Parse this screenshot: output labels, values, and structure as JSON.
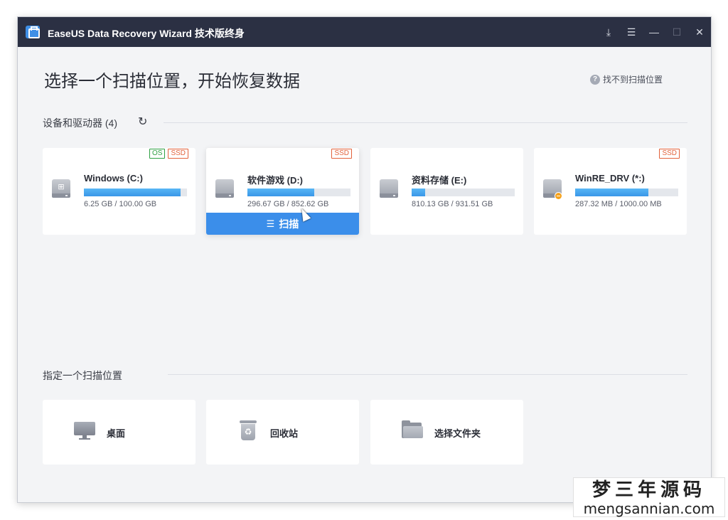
{
  "window": {
    "title": "EaseUS Data Recovery Wizard 技术版终身",
    "controls": [
      "⤓",
      "☰",
      "—",
      "☐",
      "✕"
    ]
  },
  "header": {
    "title": "选择一个扫描位置，开始恢复数据",
    "help_link": "找不到扫描位置",
    "help_icon": "?"
  },
  "devices": {
    "section_title": "设备和驱动器 (4)",
    "refresh_icon": "↻",
    "drives": [
      {
        "name": "Windows (C:)",
        "size": "6.25 GB / 100.00 GB",
        "tags": [
          "OS",
          "SSD"
        ],
        "bar_fill": 0.94,
        "icon": "windows-drive-icon"
      },
      {
        "name": "软件游戏 (D:)",
        "size": "296.67 GB / 852.62 GB",
        "tags": [
          "SSD"
        ],
        "bar_fill": 0.65,
        "icon": "hard-drive-icon",
        "scan_label": "扫描"
      },
      {
        "name": "资料存储 (E:)",
        "size": "810.13 GB / 931.51 GB",
        "tags": [],
        "bar_fill": 0.13,
        "icon": "hard-drive-icon"
      },
      {
        "name": "WinRE_DRV (*:)",
        "size": "287.32 MB / 1000.00 MB",
        "tags": [
          "SSD"
        ],
        "bar_fill": 0.71,
        "icon": "warning-drive-icon"
      }
    ]
  },
  "locations": {
    "section_title": "指定一个扫描位置",
    "items": [
      {
        "label": "桌面",
        "icon": "desktop-monitor-icon"
      },
      {
        "label": "回收站",
        "icon": "recycle-bin-icon"
      },
      {
        "label": "选择文件夹",
        "icon": "folder-icon"
      }
    ]
  },
  "watermark": {
    "cn": "梦三年源码",
    "en": "mengsannian.com"
  },
  "colors": {
    "titlebar": "#2b3043",
    "accent": "#3b8eea",
    "tag_os": "#2ea043",
    "tag_ssd": "#e2623b"
  }
}
